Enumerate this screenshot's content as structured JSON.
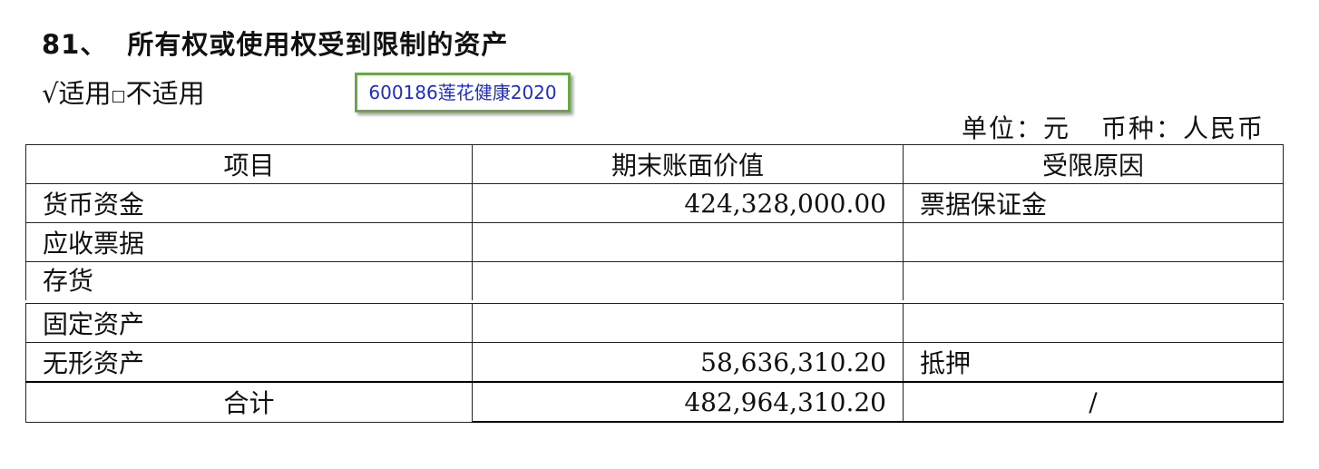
{
  "heading": {
    "number": "81、",
    "title": "所有权或使用权受到限制的资产"
  },
  "applicability": {
    "check": "√",
    "applicable": "适用",
    "box": "□",
    "not_applicable": "不适用"
  },
  "stamp": {
    "text": "600186莲花健康2020",
    "border_color": "#6aa746",
    "text_color": "#1d2bd1"
  },
  "unit": {
    "unit_label": "单位：元",
    "currency_label": "币种：人民币"
  },
  "table": {
    "headers": [
      "项目",
      "期末账面价值",
      "受限原因"
    ],
    "rows": [
      {
        "item": "货币资金",
        "value": "424,328,000.00",
        "reason": "票据保证金"
      },
      {
        "item": "应收票据",
        "value": "",
        "reason": ""
      },
      {
        "item": "存货",
        "value": "",
        "reason": ""
      },
      {
        "item": "固定资产",
        "value": "",
        "reason": ""
      },
      {
        "item": "无形资产",
        "value": "58,636,310.20",
        "reason": "抵押"
      }
    ],
    "total": {
      "item": "合计",
      "value": "482,964,310.20",
      "reason": "/"
    }
  }
}
